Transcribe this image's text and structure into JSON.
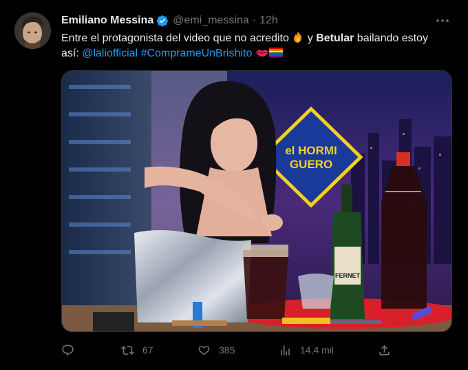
{
  "tweet": {
    "author_name": "Emiliano Messina",
    "handle": "@emi_messina",
    "separator": "·",
    "time": "12h",
    "text": {
      "part1": "Entre el protagonista del video que no acredito ",
      "part2": " y ",
      "bold": "Betular",
      "part3": " bailando estoy así: ",
      "mention": "@laliofficial",
      "space": " ",
      "hashtag": "#Compr​ameUnBrishito"
    },
    "emojis": [
      "fire-emoji",
      "lips-emoji",
      "rainbow-flag-emoji"
    ]
  },
  "media": {
    "description_icons": [
      "video-frame"
    ],
    "logo_text_line1": "el HORMI",
    "logo_text_line2": "GUERO",
    "bottle_label": "FERNET"
  },
  "actions": {
    "reply_count": "",
    "retweet_count": "67",
    "like_count": "385",
    "views_count": "14,4 mil"
  },
  "colors": {
    "background": "#000000",
    "text": "#e7e9ea",
    "muted": "#71767b",
    "link": "#1d9bf0",
    "verified": "#1d9bf0"
  }
}
